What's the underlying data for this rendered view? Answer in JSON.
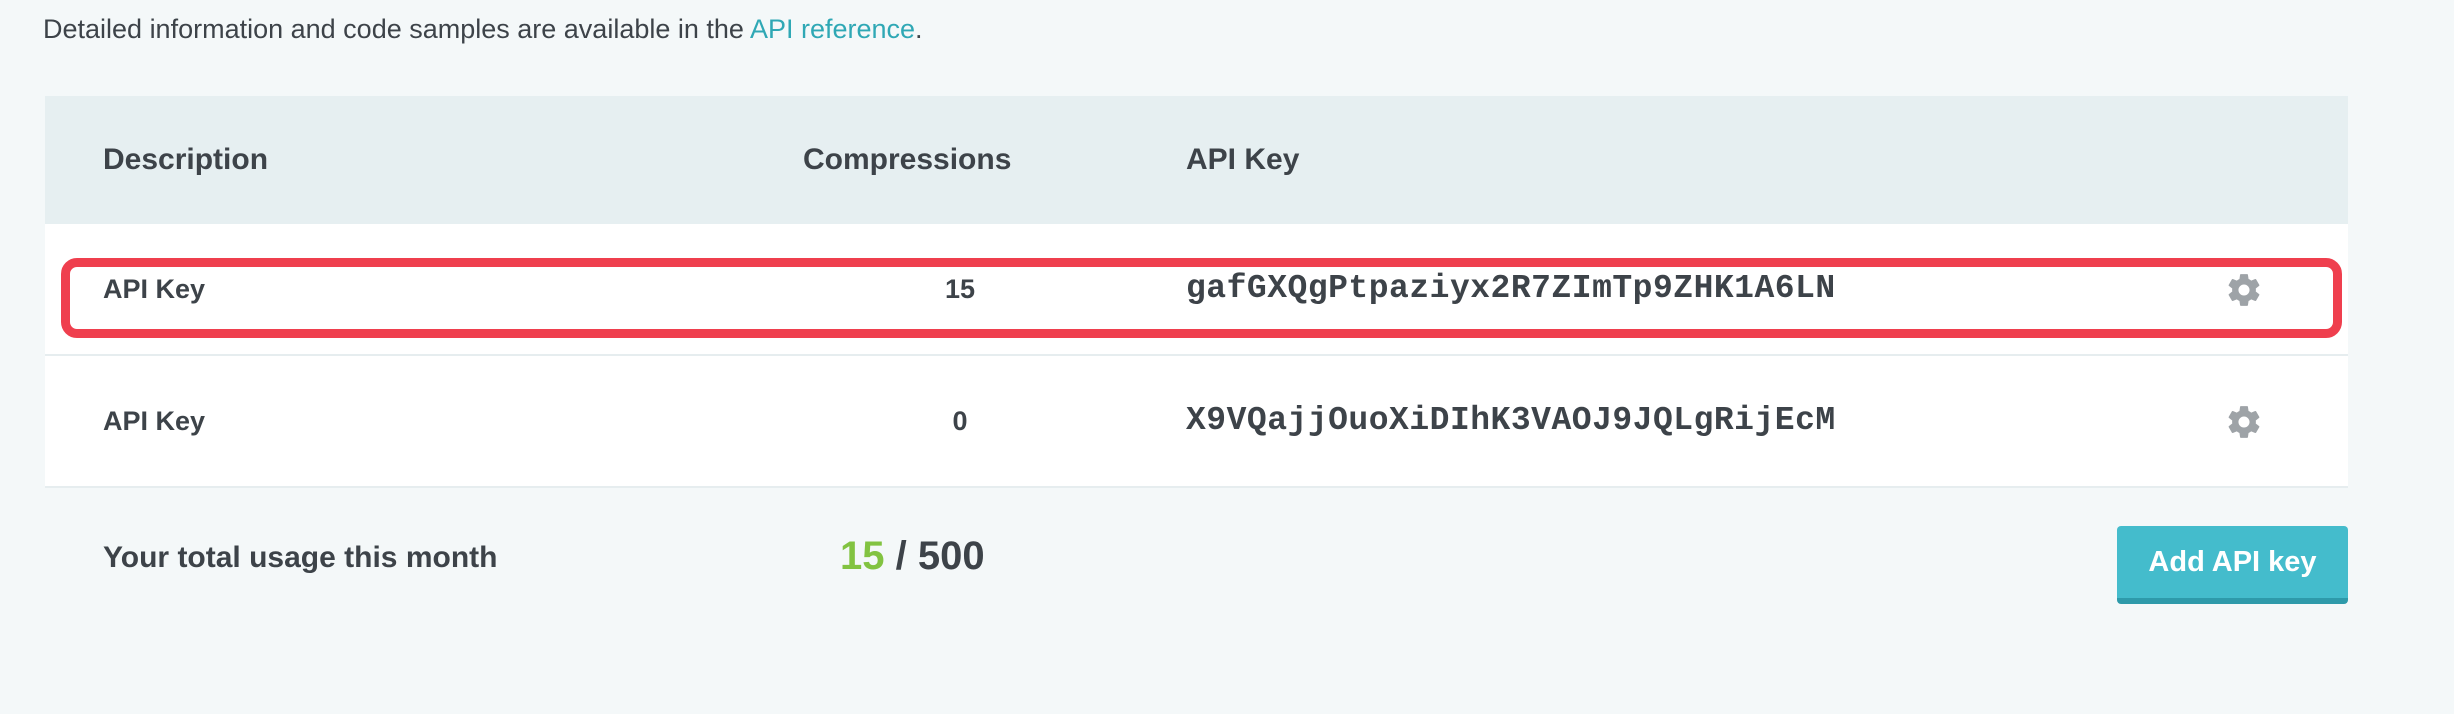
{
  "intro": {
    "text_before": "Detailed information and code samples are available in the ",
    "link_text": "API reference",
    "text_after": "."
  },
  "table": {
    "headers": {
      "description": "Description",
      "compressions": "Compressions",
      "api_key": "API Key"
    },
    "rows": [
      {
        "description": "API Key",
        "compressions": "15",
        "api_key": "gafGXQgPtpaziyx2R7ZImTp9ZHK1A6LN",
        "highlighted": true,
        "action_icon": "gear-icon"
      },
      {
        "description": "API Key",
        "compressions": "0",
        "api_key": "X9VQajjOuoXiDIhK3VAOJ9JQLgRijEcM",
        "highlighted": false,
        "action_icon": "gear-icon"
      }
    ]
  },
  "footer": {
    "label": "Your total usage this month",
    "used": "15",
    "separator": " / ",
    "limit": "500",
    "add_button_label": "Add API key"
  },
  "colors": {
    "accent": "#2fa8b5",
    "button": "#44bccc",
    "used": "#82c341",
    "highlight": "#ef3f4e",
    "header_bg": "#e6eff1",
    "page_bg": "#f4f8f9"
  }
}
